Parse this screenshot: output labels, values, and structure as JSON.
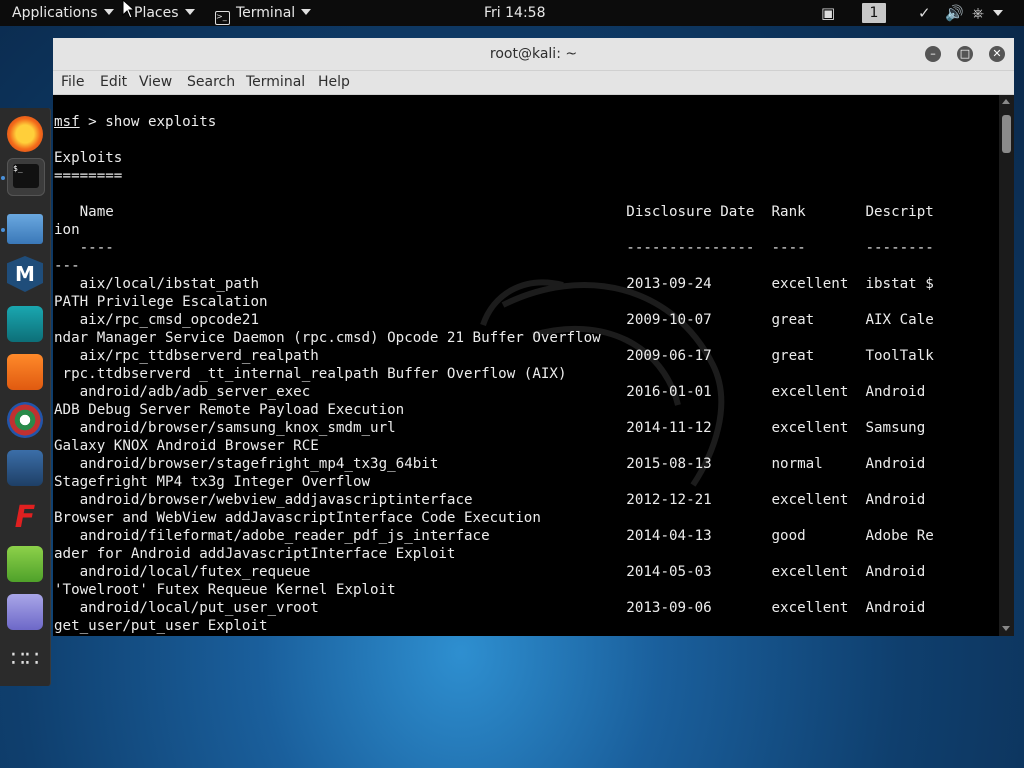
{
  "topbar": {
    "applications": "Applications",
    "places": "Places",
    "terminal": "Terminal",
    "clock": "Fri 14:58",
    "workspace": "1"
  },
  "window": {
    "title": "root@kali: ~",
    "menu": [
      "File",
      "Edit",
      "View",
      "Search",
      "Terminal",
      "Help"
    ]
  },
  "terminal": {
    "prompt": "msf",
    "command": " > show exploits",
    "lines": [
      "",
      "Exploits",
      "========",
      "",
      "   Name                                                            Disclosure Date  Rank       Descript",
      "ion",
      "   ----                                                            ---------------  ----       --------",
      "---",
      "   aix/local/ibstat_path                                           2013-09-24       excellent  ibstat $",
      "PATH Privilege Escalation",
      "   aix/rpc_cmsd_opcode21                                           2009-10-07       great      AIX Cale",
      "ndar Manager Service Daemon (rpc.cmsd) Opcode 21 Buffer Overflow",
      "   aix/rpc_ttdbserverd_realpath                                    2009-06-17       great      ToolTalk",
      " rpc.ttdbserverd _tt_internal_realpath Buffer Overflow (AIX)",
      "   android/adb/adb_server_exec                                     2016-01-01       excellent  Android",
      "ADB Debug Server Remote Payload Execution",
      "   android/browser/samsung_knox_smdm_url                           2014-11-12       excellent  Samsung",
      "Galaxy KNOX Android Browser RCE",
      "   android/browser/stagefright_mp4_tx3g_64bit                      2015-08-13       normal     Android",
      "Stagefright MP4 tx3g Integer Overflow",
      "   android/browser/webview_addjavascriptinterface                  2012-12-21       excellent  Android",
      "Browser and WebView addJavascriptInterface Code Execution",
      "   android/fileformat/adobe_reader_pdf_js_interface                2014-04-13       good       Adobe Re",
      "ader for Android addJavascriptInterface Exploit",
      "   android/local/futex_requeue                                     2014-05-03       excellent  Android",
      "'Towelroot' Futex Requeue Kernel Exploit",
      "   android/local/put_user_vroot                                    2013-09-06       excellent  Android",
      "get_user/put_user Exploit"
    ]
  },
  "dock": {
    "items": [
      "firefox-icon",
      "terminal-icon",
      "files-icon",
      "metasploit-icon",
      "armitage-icon",
      "burpsuite-icon",
      "maltego-icon",
      "beef-icon",
      "faraday-icon",
      "leafpad-icon",
      "cherrytree-icon",
      "show-apps-icon"
    ]
  },
  "colors": {
    "topbar": "#0c0c0c",
    "terminal_bg": "#000000",
    "terminal_fg": "#ececec",
    "titlebar": "#e4e4e4"
  }
}
